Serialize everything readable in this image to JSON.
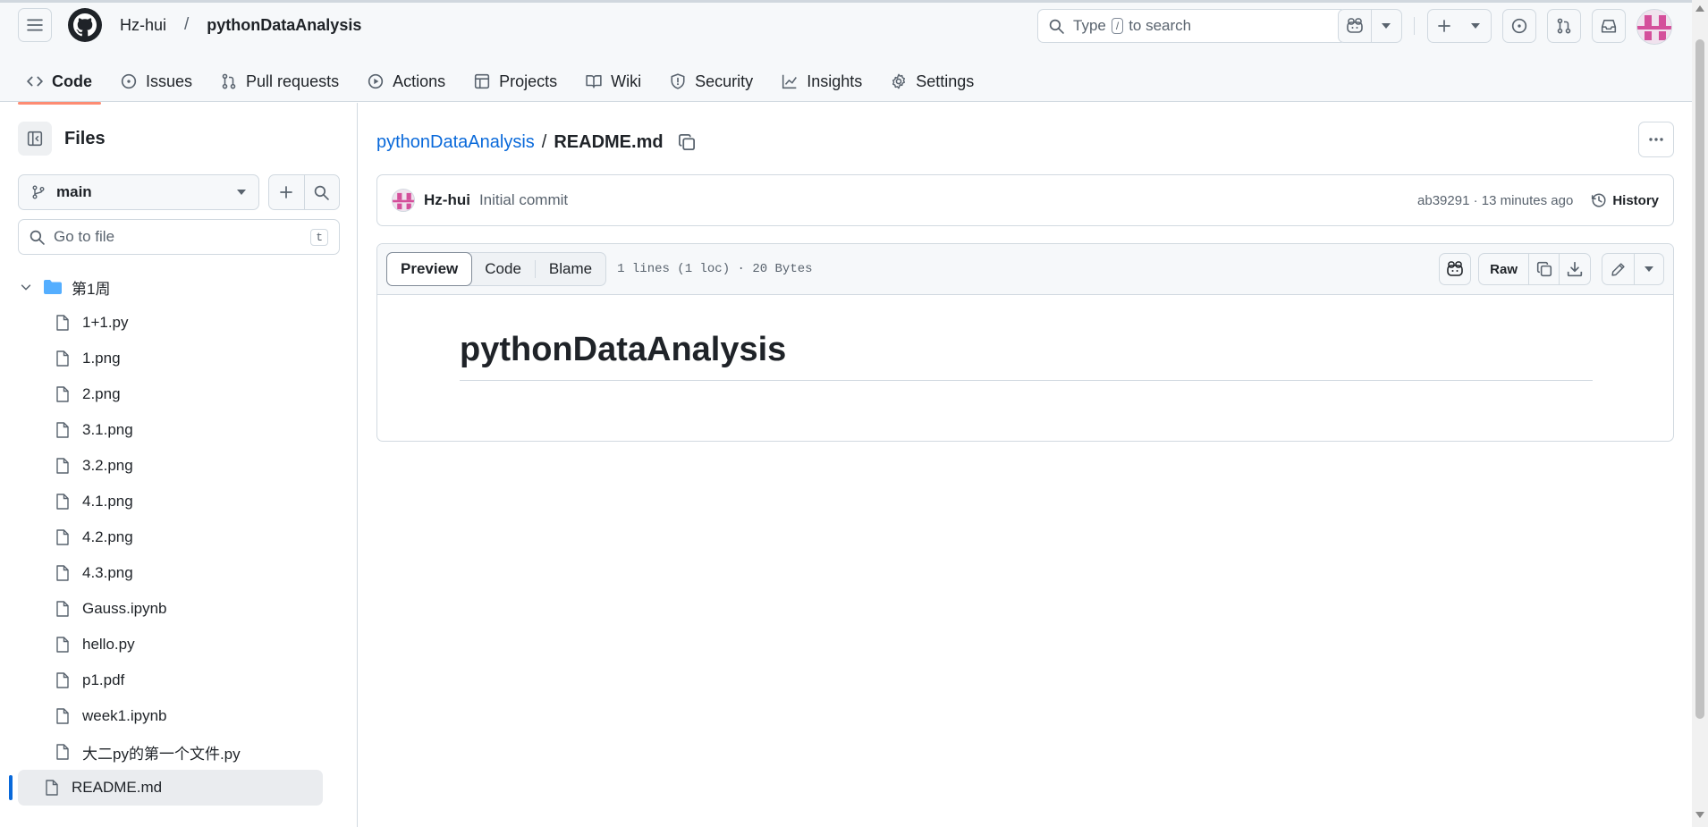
{
  "header": {
    "owner": "Hz-hui",
    "separator": "/",
    "repo": "pythonDataAnalysis",
    "search": {
      "prefix": "Type",
      "key": "/",
      "suffix": "to search"
    }
  },
  "tabs": [
    {
      "label": "Code",
      "icon": "code-icon",
      "active": true
    },
    {
      "label": "Issues",
      "icon": "issue-icon"
    },
    {
      "label": "Pull requests",
      "icon": "pull-request-icon"
    },
    {
      "label": "Actions",
      "icon": "play-icon"
    },
    {
      "label": "Projects",
      "icon": "table-icon"
    },
    {
      "label": "Wiki",
      "icon": "book-icon"
    },
    {
      "label": "Security",
      "icon": "shield-icon"
    },
    {
      "label": "Insights",
      "icon": "graph-icon"
    },
    {
      "label": "Settings",
      "icon": "gear-icon"
    }
  ],
  "sidebar": {
    "title": "Files",
    "branch": "main",
    "goto_placeholder": "Go to file",
    "goto_key": "t",
    "folder": "第1周",
    "files": [
      "1+1.py",
      "1.png",
      "2.png",
      "3.1.png",
      "3.2.png",
      "4.1.png",
      "4.2.png",
      "4.3.png",
      "Gauss.ipynb",
      "hello.py",
      "p1.pdf",
      "week1.ipynb",
      "大二py的第一个文件.py"
    ],
    "selected_file": "README.md"
  },
  "main": {
    "path_repo": "pythonDataAnalysis",
    "path_sep": "/",
    "path_file": "README.md",
    "commit": {
      "author": "Hz-hui",
      "message": "Initial commit",
      "meta": "ab39291 · 13 minutes ago",
      "history_label": "History"
    },
    "view_tabs": [
      "Preview",
      "Code",
      "Blame"
    ],
    "active_view": "Preview",
    "file_info": "1 lines (1 loc) · 20 Bytes",
    "raw_label": "Raw",
    "readme_heading": "pythonDataAnalysis"
  },
  "colors": {
    "link": "#0969da",
    "tab_underline": "#fd8c73",
    "selected_marker": "#0969da",
    "avatar_pink": "#d44f9b"
  }
}
